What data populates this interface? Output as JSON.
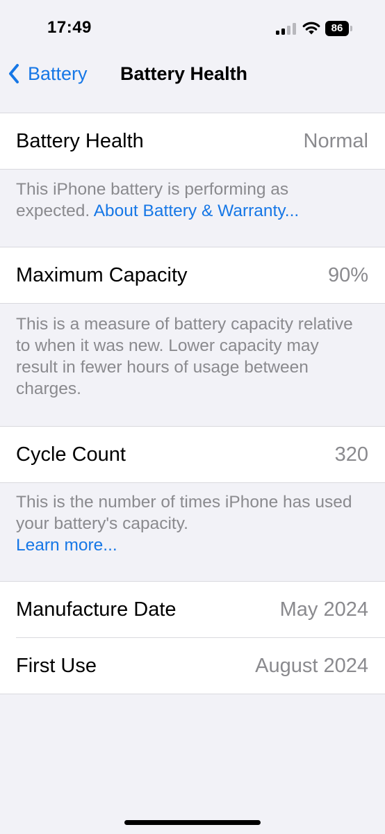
{
  "status_bar": {
    "time": "17:49",
    "battery_level": "86",
    "signal_bars_active": 2,
    "signal_bars_total": 4
  },
  "nav": {
    "back_label": "Battery",
    "title": "Battery Health"
  },
  "battery_health": {
    "label": "Battery Health",
    "value": "Normal",
    "footer_text": "This iPhone battery is performing as expected.",
    "footer_link": "About Battery & Warranty..."
  },
  "max_capacity": {
    "label": "Maximum Capacity",
    "value": "90%",
    "footer_text": "This is a measure of battery capacity relative to when it was new. Lower capacity may result in fewer hours of usage between charges."
  },
  "cycle_count": {
    "label": "Cycle Count",
    "value": "320",
    "footer_text": "This is the number of times iPhone has used your battery's capacity.",
    "footer_link": "Learn more..."
  },
  "dates": {
    "manufacture_label": "Manufacture Date",
    "manufacture_value": "May 2024",
    "first_use_label": "First Use",
    "first_use_value": "August 2024"
  },
  "colors": {
    "accent": "#1677e6",
    "background": "#f2f2f7",
    "secondary_text": "#8a8a8e"
  }
}
